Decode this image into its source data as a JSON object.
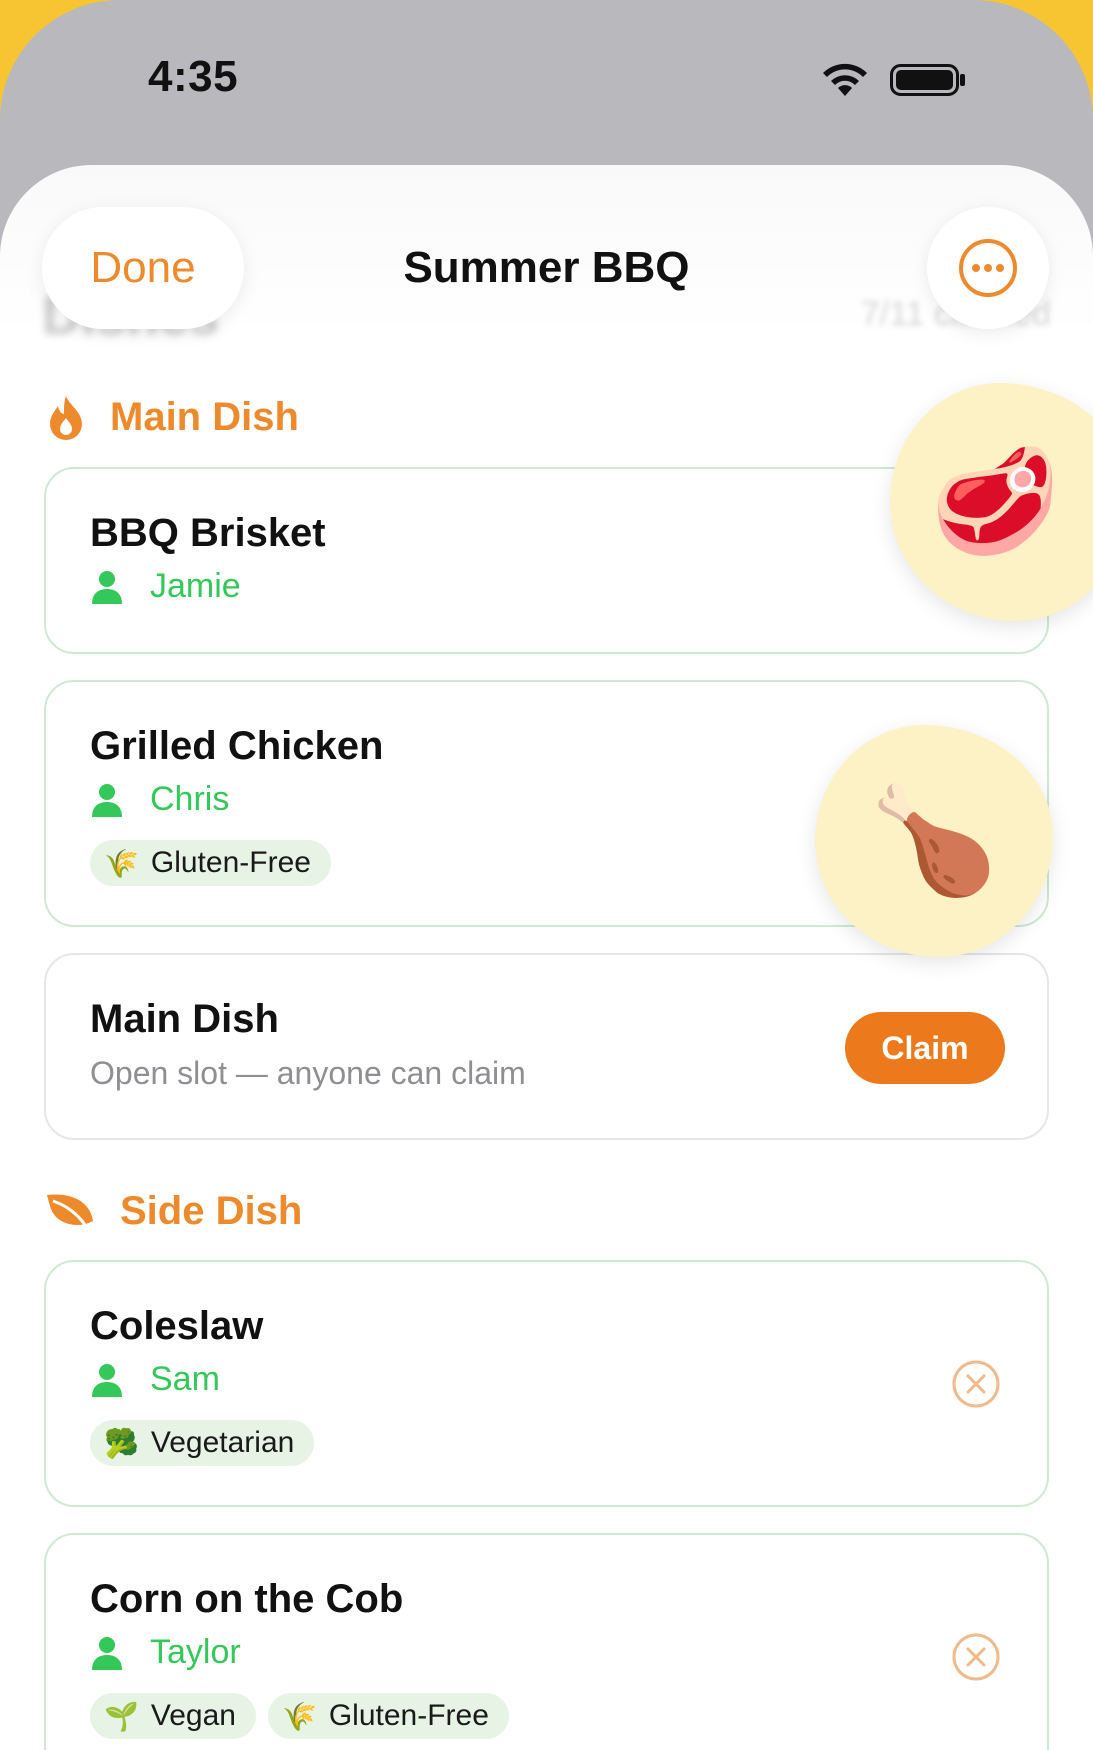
{
  "status_bar": {
    "time": "4:35"
  },
  "nav": {
    "done_label": "Done",
    "title": "Summer BBQ",
    "background_title": "Dishes",
    "background_count": "7/11 claimed"
  },
  "sections": [
    {
      "title": "Main Dish",
      "icon": "flame-icon",
      "items": [
        {
          "name": "BBQ Brisket",
          "person": "Jamie",
          "tags": []
        },
        {
          "name": "Grilled Chicken",
          "person": "Chris",
          "tags": [
            {
              "emoji": "🌾",
              "label": "Gluten-Free"
            }
          ]
        },
        {
          "name": "Main Dish",
          "subtitle": "Open slot — anyone can claim",
          "action": "Claim"
        }
      ]
    },
    {
      "title": "Side Dish",
      "icon": "leaf-icon",
      "items": [
        {
          "name": "Coleslaw",
          "person": "Sam",
          "tags": [
            {
              "emoji": "🥦",
              "label": "Vegetarian"
            }
          ]
        },
        {
          "name": "Corn on the Cob",
          "person": "Taylor",
          "tags": [
            {
              "emoji": "🌱",
              "label": "Vegan"
            },
            {
              "emoji": "🌾",
              "label": "Gluten-Free"
            }
          ]
        }
      ]
    }
  ],
  "floating_stickers": [
    {
      "icon": "steak-sticker-icon",
      "emoji": "🥩"
    },
    {
      "icon": "drumstick-sticker-icon",
      "emoji": "🍗"
    }
  ],
  "colors": {
    "accent": "#ec8a2c",
    "claim": "#ec7a1c",
    "person": "#34c759",
    "card_border": "#cfe9d2",
    "tag_bg": "#e6f3e5"
  }
}
